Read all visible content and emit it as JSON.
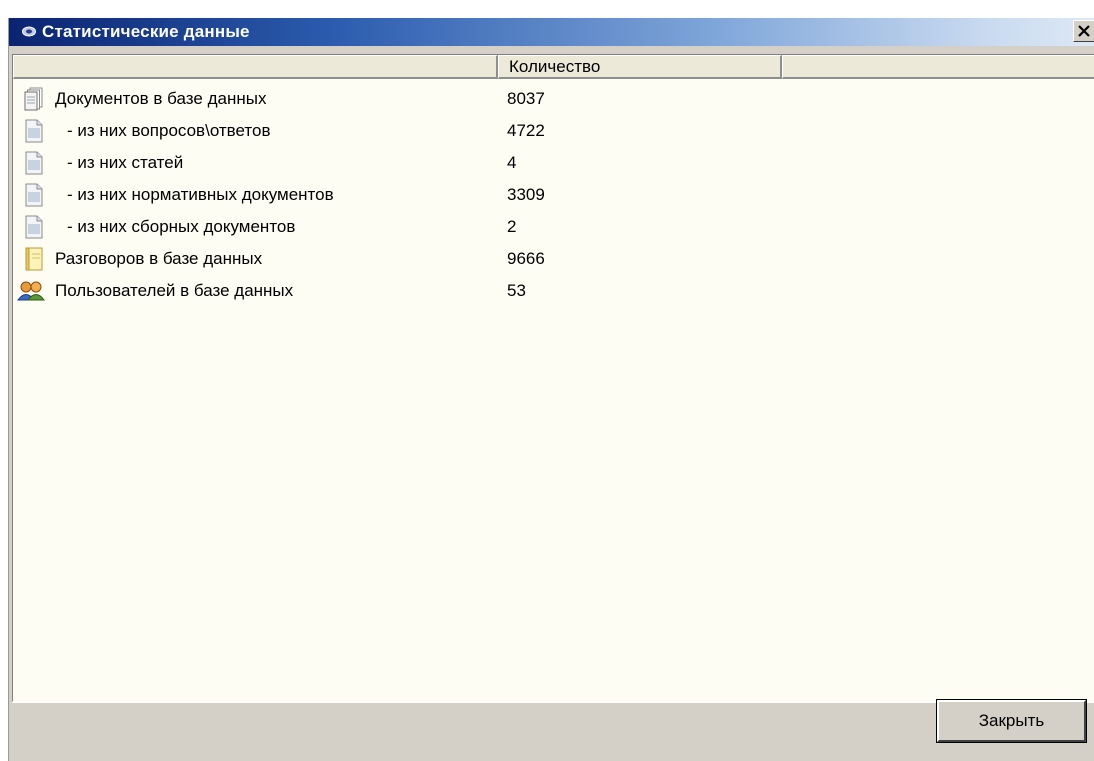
{
  "window": {
    "title": "Статистические данные",
    "close_glyph": "x"
  },
  "table": {
    "columns": [
      "",
      "Количество",
      ""
    ],
    "rows": [
      {
        "icon": "document-stack-icon",
        "label": "Документов в базе данных",
        "value": "8037",
        "indent": false
      },
      {
        "icon": "document-icon",
        "label": "- из них вопросов\\ответов",
        "value": "4722",
        "indent": true
      },
      {
        "icon": "document-icon",
        "label": "- из них статей",
        "value": "4",
        "indent": true
      },
      {
        "icon": "document-icon",
        "label": "- из них нормативных документов",
        "value": "3309",
        "indent": true
      },
      {
        "icon": "document-icon",
        "label": "- из них сборных документов",
        "value": "2",
        "indent": true
      },
      {
        "icon": "conversation-icon",
        "label": "Разговоров в базе данных",
        "value": "9666",
        "indent": false
      },
      {
        "icon": "users-icon",
        "label": "Пользователей в базе данных",
        "value": "53",
        "indent": false
      }
    ]
  },
  "footer": {
    "close_label": "Закрыть"
  }
}
